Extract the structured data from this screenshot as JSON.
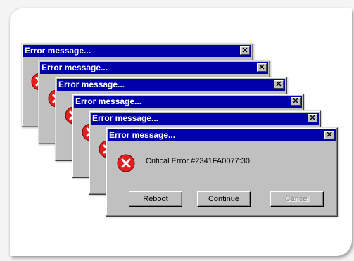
{
  "dialogs": [
    {
      "title": "Error message...",
      "close": "✕"
    },
    {
      "title": "Error message...",
      "close": "✕"
    },
    {
      "title": "Error message...",
      "close": "✕"
    },
    {
      "title": "Error message...",
      "close": "✕"
    },
    {
      "title": "Error message...",
      "close": "✕"
    },
    {
      "title": "Error message...",
      "close": "✕"
    }
  ],
  "main_dialog": {
    "message": "Critical Error #2341FA0077:30",
    "buttons": {
      "reboot": "Reboot",
      "continue": "Continue",
      "cancel": "Cancel"
    }
  },
  "colors": {
    "titlebar": "#0000a8",
    "dialog_face": "#c0c0c0",
    "error_icon": "#e02020"
  },
  "icons": {
    "error": "error-icon",
    "close": "close-icon"
  }
}
